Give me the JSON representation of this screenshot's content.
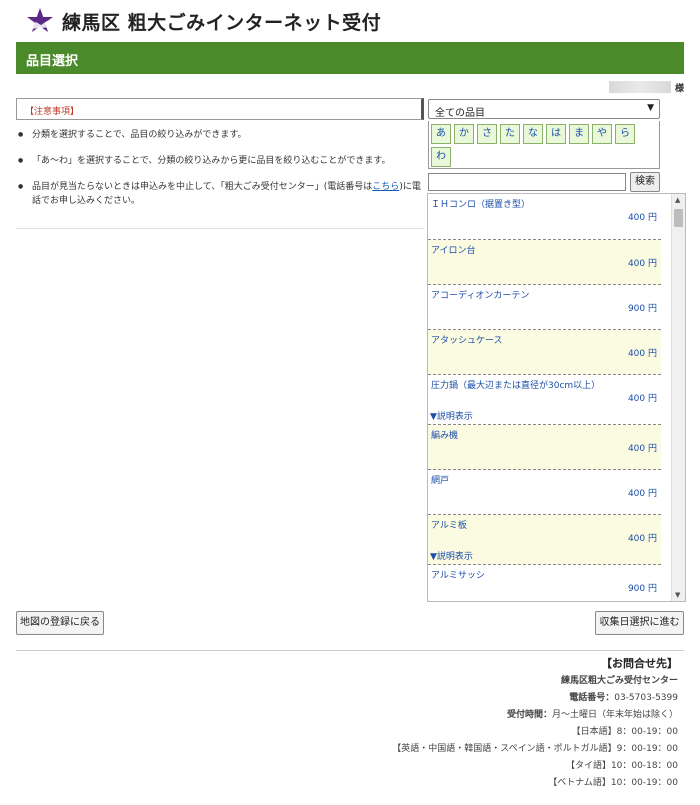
{
  "header": {
    "logo_icon": "star-mountain-logo",
    "site_title": "練馬区 粗大ごみインターネット受付"
  },
  "page": {
    "title": "品目選択"
  },
  "user": {
    "suffix": "様"
  },
  "notice": {
    "title": "【注意事項】",
    "items": [
      "分類を選択することで、品目の絞り込みができます。",
      "「あ～わ」を選択することで、分類の絞り込みから更に品目を絞り込むことができます。"
    ],
    "item3_before": "品目が見当たらないときは申込みを中止して、「粗大ごみ受付センター」(電話番号は",
    "item3_link": "こちら",
    "item3_after": ")に電話でお申し込みください。"
  },
  "category": {
    "selected": "全ての品目",
    "options": [
      "全ての品目"
    ]
  },
  "kana": [
    "あ",
    "か",
    "さ",
    "た",
    "な",
    "は",
    "ま",
    "や",
    "ら",
    "わ"
  ],
  "search": {
    "value": "",
    "placeholder": "",
    "button_label": "検索"
  },
  "items": [
    {
      "name": "ＩＨコンロ（据置き型）",
      "price": "400 円",
      "desc": ""
    },
    {
      "name": "アイロン台",
      "price": "400 円",
      "desc": ""
    },
    {
      "name": "アコーディオンカーテン",
      "price": "900 円",
      "desc": ""
    },
    {
      "name": "アタッシュケース",
      "price": "400 円",
      "desc": ""
    },
    {
      "name": "圧力鍋（最大辺または直径が30cm以上）",
      "price": "400 円",
      "desc": "▼説明表示"
    },
    {
      "name": "編み機",
      "price": "400 円",
      "desc": ""
    },
    {
      "name": "網戸",
      "price": "400 円",
      "desc": ""
    },
    {
      "name": "アルミ板",
      "price": "400 円",
      "desc": "▼説明表示"
    },
    {
      "name": "アルミサッシ",
      "price": "900 円",
      "desc": ""
    }
  ],
  "nav": {
    "back_label": "地図の登録に戻る",
    "next_label": "収集日選択に進む"
  },
  "footer": {
    "title": "【お問合せ先】",
    "center": "練馬区粗大ごみ受付センター",
    "phone_label": "電話番号：",
    "phone": "03-5703-5399",
    "hours_label": "受付時間：",
    "hours": "月～土曜日（年末年始は除く）",
    "language_hours": [
      "【日本語】8：00-19：00",
      "【英語・中国語・韓国語・スペイン語・ポルトガル語】9：00-19：00",
      "【タイ語】10：00-18：00",
      "【ベトナム語】10：00-19：00"
    ]
  },
  "colors": {
    "header_bar": "#4b8a2a",
    "logo_purple": "#5b2a86",
    "link_blue": "#1a4ea8",
    "notice_red": "#c0392b",
    "kana_bg": "#e8f8d8",
    "item_shade": "#fbfbe2"
  }
}
